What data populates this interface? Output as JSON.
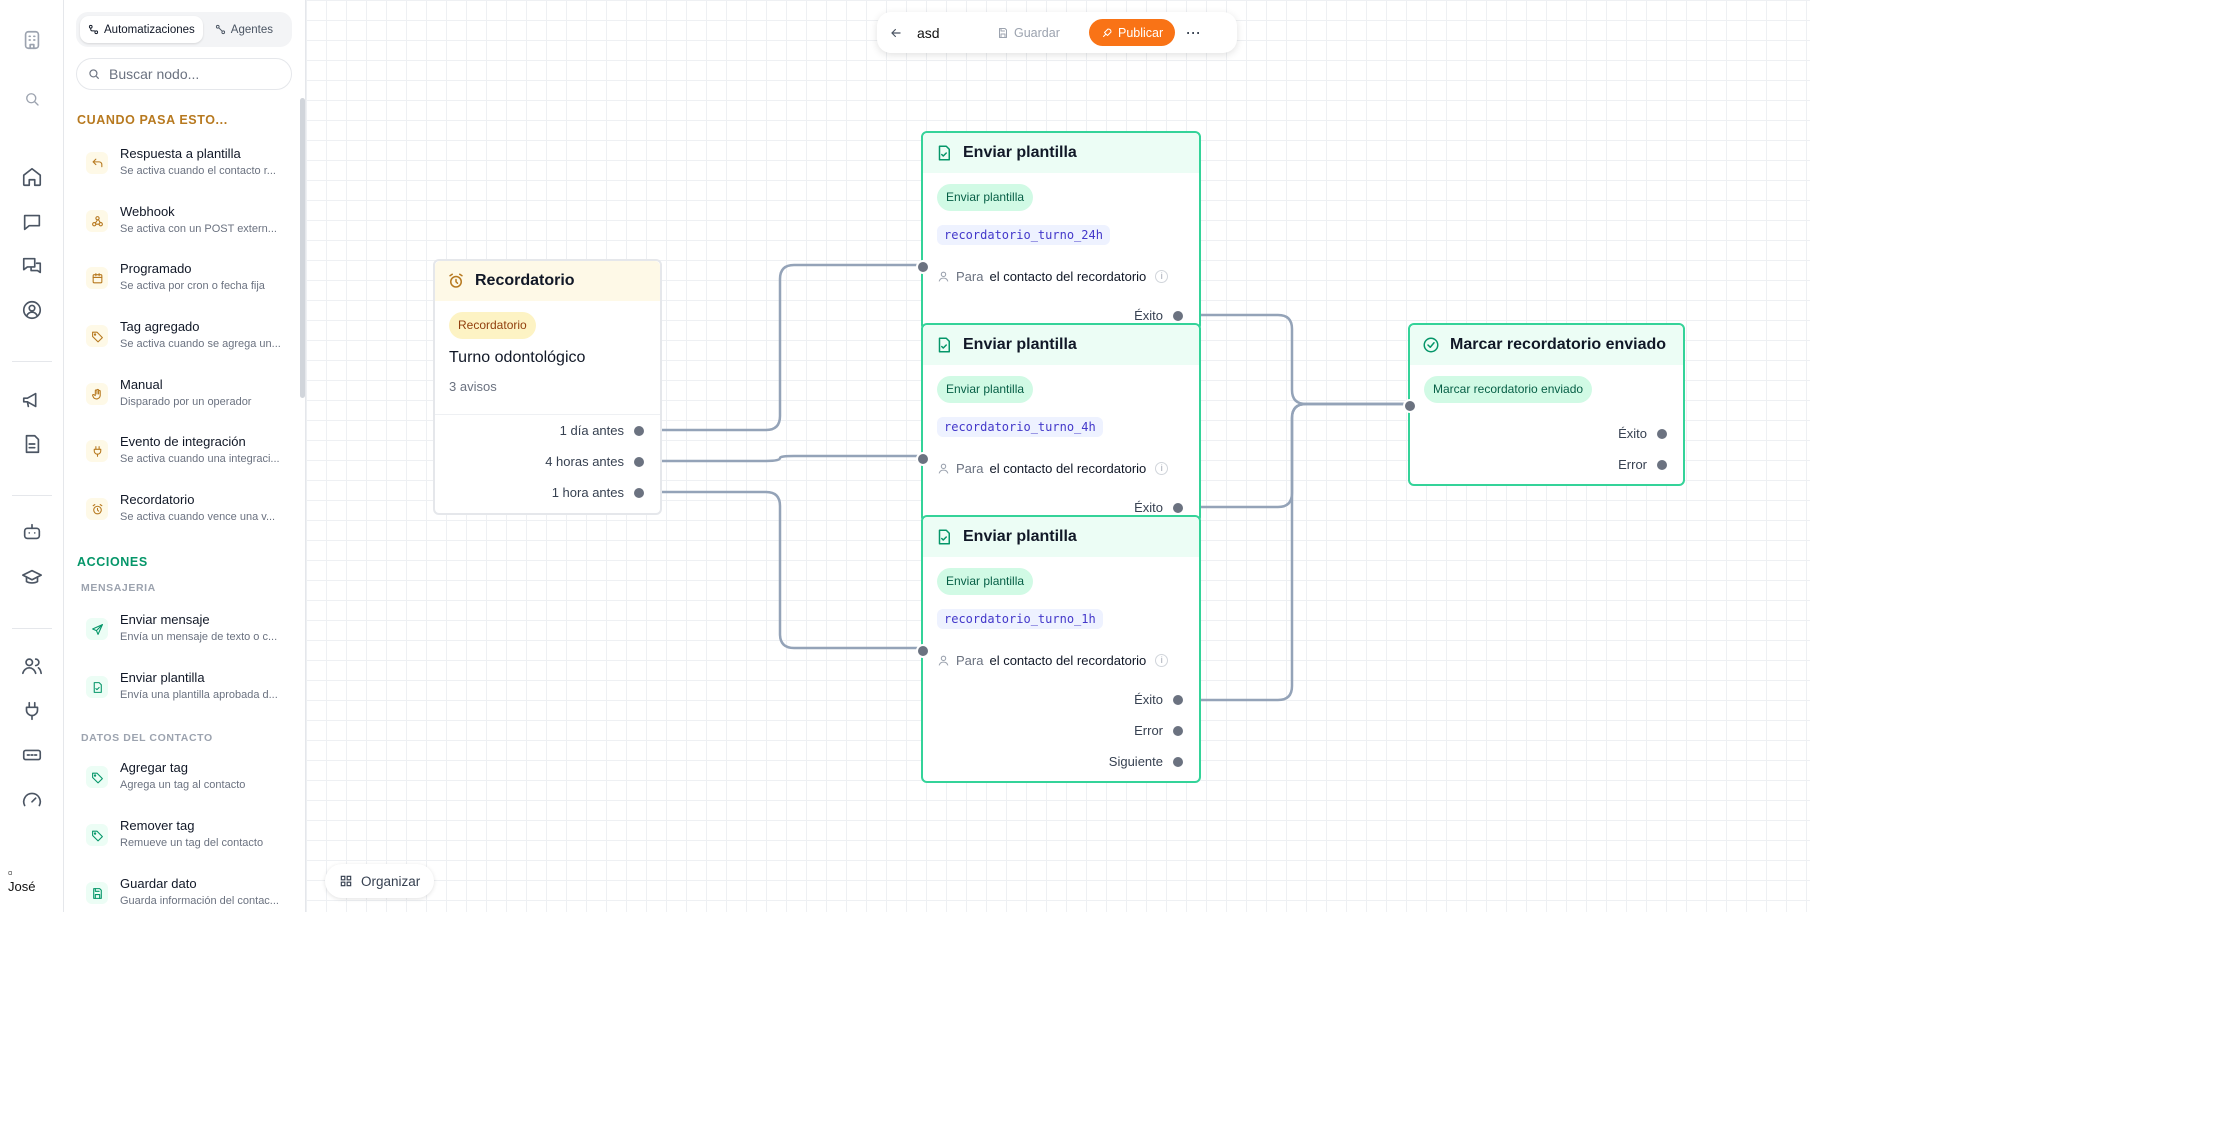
{
  "rail": {
    "icons": [
      "building-icon",
      "search-icon",
      "home-icon",
      "chat-icon",
      "conversations-icon",
      "user-circle-icon",
      "megaphone-icon",
      "document-icon",
      "bot-icon",
      "graduation-cap-icon",
      "users-icon",
      "plug-icon",
      "keyboard-icon",
      "gauge-icon"
    ],
    "user": "José"
  },
  "panel": {
    "tabs": [
      {
        "label": "Automatizaciones",
        "active": true
      },
      {
        "label": "Agentes",
        "active": false
      }
    ],
    "search_placeholder": "Buscar nodo...",
    "triggers_title": "CUANDO PASA ESTO...",
    "triggers": [
      {
        "title": "Respuesta a plantilla",
        "desc": "Se activa cuando el contacto r..."
      },
      {
        "title": "Webhook",
        "desc": "Se activa con un POST extern..."
      },
      {
        "title": "Programado",
        "desc": "Se activa por cron o fecha fija"
      },
      {
        "title": "Tag agregado",
        "desc": "Se activa cuando se agrega un..."
      },
      {
        "title": "Manual",
        "desc": "Disparado por un operador"
      },
      {
        "title": "Evento de integración",
        "desc": "Se activa cuando una integraci..."
      },
      {
        "title": "Recordatorio",
        "desc": "Se activa cuando vence una v..."
      }
    ],
    "actions_title": "ACCIONES",
    "messaging_title": "MENSAJERIA",
    "messaging": [
      {
        "title": "Enviar mensaje",
        "desc": "Envía un mensaje de texto o c..."
      },
      {
        "title": "Enviar plantilla",
        "desc": "Envía una plantilla aprobada d..."
      }
    ],
    "contact_title": "DATOS DEL CONTACTO",
    "contact": [
      {
        "title": "Agregar tag",
        "desc": "Agrega un tag al contacto"
      },
      {
        "title": "Remover tag",
        "desc": "Remueve un tag del contacto"
      },
      {
        "title": "Guardar dato",
        "desc": "Guarda información del contac..."
      }
    ]
  },
  "topbar": {
    "name": "asd",
    "save": "Guardar",
    "publish": "Publicar",
    "more": "···"
  },
  "nodes": {
    "reminder": {
      "title": "Recordatorio",
      "badge": "Recordatorio",
      "name": "Turno odontológico",
      "count": "3 avisos",
      "ports": [
        "1 día antes",
        "4 horas antes",
        "1 hora antes"
      ]
    },
    "t1": {
      "title": "Enviar plantilla",
      "badge": "Enviar plantilla",
      "code": "recordatorio_turno_24h",
      "to_prefix": "Para",
      "to": "el contacto del recordatorio",
      "ports": [
        "Éxito"
      ]
    },
    "t2": {
      "title": "Enviar plantilla",
      "badge": "Enviar plantilla",
      "code": "recordatorio_turno_4h",
      "to_prefix": "Para",
      "to": "el contacto del recordatorio",
      "ports": [
        "Éxito"
      ]
    },
    "t3": {
      "title": "Enviar plantilla",
      "badge": "Enviar plantilla",
      "code": "recordatorio_turno_1h",
      "to_prefix": "Para",
      "to": "el contacto del recordatorio",
      "ports": [
        "Éxito",
        "Error",
        "Siguiente"
      ]
    },
    "mark": {
      "title": "Marcar recordatorio enviado",
      "badge": "Marcar recordatorio enviado",
      "ports": [
        "Éxito",
        "Error"
      ]
    }
  },
  "organize": "Organizar",
  "colors": {
    "accent": "#f97316",
    "trigger": "#b7791f",
    "action": "#059669",
    "node_border": "#34d399",
    "trigger_header": "#fef9e7",
    "wire": "#94a3b8"
  }
}
